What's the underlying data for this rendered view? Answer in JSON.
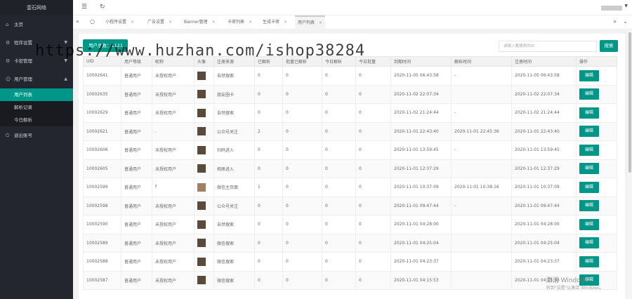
{
  "sidebar": {
    "logo": "壹石网络",
    "items": [
      {
        "icon": "home-icon",
        "label": "主页"
      },
      {
        "icon": "settings-icon",
        "label": "程序设置"
      },
      {
        "icon": "gear-icon",
        "label": "卡密管理"
      },
      {
        "icon": "user-icon",
        "label": "用户管理"
      }
    ],
    "sub_items": [
      "用户列表",
      "解析记录",
      "今日解析"
    ],
    "logout": "退出账号"
  },
  "tabs": [
    "小程序设置",
    "广告设置",
    "Banner管理",
    "卡密列表",
    "生成卡密",
    "用户列表"
  ],
  "toolbar": {
    "total_label": "用户总数：1121",
    "search_placeholder": "请输入要搜索的ID",
    "search_button": "搜索"
  },
  "table": {
    "headers": [
      "UID",
      "用户等级",
      "昵称",
      "头像",
      "注册来源",
      "已解析",
      "批量已解析",
      "今日解析",
      "今日批量",
      "到期时间",
      "解析时间",
      "注册时间",
      "操作"
    ],
    "rows": [
      [
        "10002641",
        "普通用户",
        "未授权用户",
        "",
        "自然搜索",
        "0",
        "0",
        "0",
        "0",
        "2020-11-05 06:43:58",
        "-",
        "2020-11-05 06:43:58",
        "编辑"
      ],
      [
        "10002635",
        "普通用户",
        "未授权用户",
        "",
        "朋友圈卡",
        "0",
        "0",
        "0",
        "0",
        "2020-11-02 22:07:34",
        "",
        "2020-11-02 22:07:34",
        "编辑"
      ],
      [
        "10002629",
        "普通用户",
        "未授权用户",
        "",
        "自然搜索",
        "0",
        "0",
        "0",
        "0",
        "2020-11-02 21:24:44",
        "-",
        "2020-11-02 21:24:44",
        "编辑"
      ],
      [
        "10002621",
        "普通用户",
        ".",
        "",
        "公众号关注",
        "2",
        "0",
        "0",
        "0",
        "2020-11-01 22:43:40",
        "2020-11-01 22:45:36",
        "2020-11-01 22:43:40",
        "编辑"
      ],
      [
        "10002606",
        "普通用户",
        "未授权用户",
        "",
        "扫码进入",
        "0",
        "0",
        "0",
        "0",
        "2020-11-01 13:59:45",
        "-",
        "2020-11-01 13:59:45",
        "编辑"
      ],
      [
        "10002605",
        "普通用户",
        "未授权用户",
        "",
        "相册进入",
        "0",
        "0",
        "0",
        "0",
        "2020-11-01 12:37:29",
        "",
        "2020-11-01 12:37:29",
        "编辑"
      ],
      [
        "10002599",
        "普通用户",
        "f",
        "",
        "微信主页面",
        "1",
        "0",
        "0",
        "0",
        "2020-11-01 10:37:09",
        "2020-11-01 10:38:16",
        "2020-11-01 10:37:09",
        "编辑"
      ],
      [
        "10002598",
        "普通用户",
        "未授权用户",
        "",
        "公众号关注",
        "0",
        "0",
        "0",
        "0",
        "2020-11-01 09:47:44",
        "-",
        "2020-11-01 09:47:44",
        "编辑"
      ],
      [
        "10002590",
        "普通用户",
        "未授权用户",
        "",
        "自然搜索",
        "0",
        "0",
        "0",
        "0",
        "2020-11-01 04:28:00",
        "",
        "2020-11-01 04:28:00",
        "编辑"
      ],
      [
        "10002589",
        "普通用户",
        "未授权用户",
        "",
        "微信搜索",
        "0",
        "0",
        "0",
        "0",
        "2020-11-01 04:25:04",
        "",
        "2020-11-01 04:25:04",
        "编辑"
      ],
      [
        "10002588",
        "普通用户",
        "未授权用户",
        "",
        "微信搜索",
        "0",
        "0",
        "0",
        "0",
        "2020-11-01 04:23:37",
        "",
        "2020-11-01 04:23:37",
        "编辑"
      ],
      [
        "10002587",
        "普通用户",
        "未授权用户",
        "",
        "微信搜索",
        "0",
        "0",
        "0",
        "0",
        "2020-11-01 04:15:53",
        "",
        "2020-11-01 04:15:53",
        "编辑"
      ]
    ]
  },
  "watermark": "https://www.huzhan.com/ishop38284",
  "windows_watermark": {
    "title": "激活 Windows",
    "subtitle": "转到\"设置\"以激活 Windows。"
  },
  "colors": {
    "accent": "#009688",
    "sidebar": "#23262e"
  }
}
